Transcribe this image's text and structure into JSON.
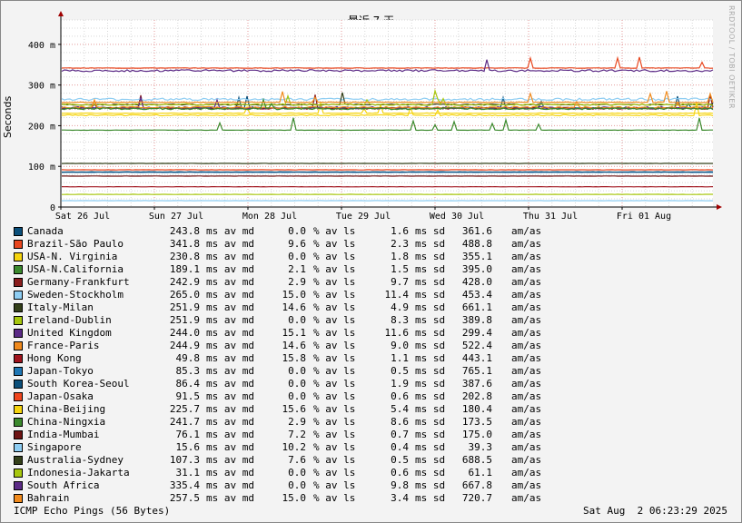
{
  "chart_data": {
    "type": "line",
    "title": "最近 7 天",
    "ylabel": "Seconds",
    "ylim": [
      0,
      460
    ],
    "yticks": [
      {
        "value": 0,
        "label": "0"
      },
      {
        "value": 100,
        "label": "100 m"
      },
      {
        "value": 200,
        "label": "200 m"
      },
      {
        "value": 300,
        "label": "300 m"
      },
      {
        "value": 400,
        "label": "400 m"
      }
    ],
    "xticks": [
      "Sat 26 Jul",
      "Sun 27 Jul",
      "Mon 28 Jul",
      "Tue 29 Jul",
      "Wed 30 Jul",
      "Thu 31 Jul",
      "Fri 01 Aug"
    ],
    "grid": true,
    "watermark": "RRDTOOL / TOBI OETIKER",
    "series": [
      {
        "name": "Canada",
        "median": "243.8",
        "median_unit": "ms av md",
        "loss": "0.0",
        "loss_unit": "% av ls",
        "sd": "1.6",
        "sd_unit": "ms sd",
        "ratio": "361.6",
        "ratio_unit": "am/as",
        "color": "#0b4f7a",
        "y": 243.8
      },
      {
        "name": "Brazil-São Paulo",
        "median": "341.8",
        "median_unit": "ms av md",
        "loss": "9.6",
        "loss_unit": "% av ls",
        "sd": "2.3",
        "sd_unit": "ms sd",
        "ratio": "488.8",
        "ratio_unit": "am/as",
        "color": "#e8461e",
        "y": 341.8
      },
      {
        "name": "USA-N. Virginia",
        "median": "230.8",
        "median_unit": "ms av md",
        "loss": "0.0",
        "loss_unit": "% av ls",
        "sd": "1.8",
        "sd_unit": "ms sd",
        "ratio": "355.1",
        "ratio_unit": "am/as",
        "color": "#f5d40f",
        "y": 230.8
      },
      {
        "name": "USA-N.California",
        "median": "189.1",
        "median_unit": "ms av md",
        "loss": "2.1",
        "loss_unit": "% av ls",
        "sd": "1.5",
        "sd_unit": "ms sd",
        "ratio": "395.0",
        "ratio_unit": "am/as",
        "color": "#3c8a2e",
        "y": 189.1
      },
      {
        "name": "Germany-Frankfurt",
        "median": "242.9",
        "median_unit": "ms av md",
        "loss": "2.9",
        "loss_unit": "% av ls",
        "sd": "9.7",
        "sd_unit": "ms sd",
        "ratio": "428.0",
        "ratio_unit": "am/as",
        "color": "#8a1e1e",
        "y": 242.9
      },
      {
        "name": "Sweden-Stockholm",
        "median": "265.0",
        "median_unit": "ms av md",
        "loss": "15.0",
        "loss_unit": "% av ls",
        "sd": "11.4",
        "sd_unit": "ms sd",
        "ratio": "453.4",
        "ratio_unit": "am/as",
        "color": "#8ecdf2",
        "y": 265.0
      },
      {
        "name": "Italy-Milan",
        "median": "251.9",
        "median_unit": "ms av md",
        "loss": "14.6",
        "loss_unit": "% av ls",
        "sd": "4.9",
        "sd_unit": "ms sd",
        "ratio": "661.1",
        "ratio_unit": "am/as",
        "color": "#34401a",
        "y": 251.9
      },
      {
        "name": "Ireland-Dublin",
        "median": "251.9",
        "median_unit": "ms av md",
        "loss": "0.0",
        "loss_unit": "% av ls",
        "sd": "8.3",
        "sd_unit": "ms sd",
        "ratio": "389.8",
        "ratio_unit": "am/as",
        "color": "#a7c70e",
        "y": 251.9
      },
      {
        "name": "United Kingdom",
        "median": "244.0",
        "median_unit": "ms av md",
        "loss": "15.1",
        "loss_unit": "% av ls",
        "sd": "11.6",
        "sd_unit": "ms sd",
        "ratio": "299.4",
        "ratio_unit": "am/as",
        "color": "#5b2a86",
        "y": 244.0
      },
      {
        "name": "France-Paris",
        "median": "244.9",
        "median_unit": "ms av md",
        "loss": "14.6",
        "loss_unit": "% av ls",
        "sd": "9.0",
        "sd_unit": "ms sd",
        "ratio": "522.4",
        "ratio_unit": "am/as",
        "color": "#f08a1d",
        "y": 244.9
      },
      {
        "name": "Hong Kong",
        "median": "49.8",
        "median_unit": "ms av md",
        "loss": "15.8",
        "loss_unit": "% av ls",
        "sd": "1.1",
        "sd_unit": "ms sd",
        "ratio": "443.1",
        "ratio_unit": "am/as",
        "color": "#a0141e",
        "y": 49.8
      },
      {
        "name": "Japan-Tokyo",
        "median": "85.3",
        "median_unit": "ms av md",
        "loss": "0.0",
        "loss_unit": "% av ls",
        "sd": "0.5",
        "sd_unit": "ms sd",
        "ratio": "765.1",
        "ratio_unit": "am/as",
        "color": "#1f77b4",
        "y": 85.3
      },
      {
        "name": "South Korea-Seoul",
        "median": "86.4",
        "median_unit": "ms av md",
        "loss": "0.0",
        "loss_unit": "% av ls",
        "sd": "1.9",
        "sd_unit": "ms sd",
        "ratio": "387.6",
        "ratio_unit": "am/as",
        "color": "#0b4f7a",
        "y": 86.4
      },
      {
        "name": "Japan-Osaka",
        "median": "91.5",
        "median_unit": "ms av md",
        "loss": "0.0",
        "loss_unit": "% av ls",
        "sd": "0.6",
        "sd_unit": "ms sd",
        "ratio": "202.8",
        "ratio_unit": "am/as",
        "color": "#f0461e",
        "y": 91.5
      },
      {
        "name": "China-Beijing",
        "median": "225.7",
        "median_unit": "ms av md",
        "loss": "15.6",
        "loss_unit": "% av ls",
        "sd": "5.4",
        "sd_unit": "ms sd",
        "ratio": "180.4",
        "ratio_unit": "am/as",
        "color": "#f5d40f",
        "y": 225.7
      },
      {
        "name": "China-Ningxia",
        "median": "241.7",
        "median_unit": "ms av md",
        "loss": "2.9",
        "loss_unit": "% av ls",
        "sd": "8.6",
        "sd_unit": "ms sd",
        "ratio": "173.5",
        "ratio_unit": "am/as",
        "color": "#3c8a2e",
        "y": 241.7
      },
      {
        "name": "India-Mumbai",
        "median": "76.1",
        "median_unit": "ms av md",
        "loss": "7.2",
        "loss_unit": "% av ls",
        "sd": "0.7",
        "sd_unit": "ms sd",
        "ratio": "175.0",
        "ratio_unit": "am/as",
        "color": "#6e1414",
        "y": 76.1
      },
      {
        "name": "Singapore",
        "median": "15.6",
        "median_unit": "ms av md",
        "loss": "10.2",
        "loss_unit": "% av ls",
        "sd": "0.4",
        "sd_unit": "ms sd",
        "ratio": "39.3",
        "ratio_unit": "am/as",
        "color": "#8ecdf2",
        "y": 15.6
      },
      {
        "name": "Australia-Sydney",
        "median": "107.3",
        "median_unit": "ms av md",
        "loss": "7.6",
        "loss_unit": "% av ls",
        "sd": "0.5",
        "sd_unit": "ms sd",
        "ratio": "688.5",
        "ratio_unit": "am/as",
        "color": "#34401a",
        "y": 107.3
      },
      {
        "name": "Indonesia-Jakarta",
        "median": "31.1",
        "median_unit": "ms av md",
        "loss": "0.0",
        "loss_unit": "% av ls",
        "sd": "0.6",
        "sd_unit": "ms sd",
        "ratio": "61.1",
        "ratio_unit": "am/as",
        "color": "#a7c70e",
        "y": 31.1
      },
      {
        "name": "South Africa",
        "median": "335.4",
        "median_unit": "ms av md",
        "loss": "0.0",
        "loss_unit": "% av ls",
        "sd": "9.8",
        "sd_unit": "ms sd",
        "ratio": "667.8",
        "ratio_unit": "am/as",
        "color": "#5b2a86",
        "y": 335.4
      },
      {
        "name": "Bahrain",
        "median": "257.5",
        "median_unit": "ms av md",
        "loss": "15.0",
        "loss_unit": "% av ls",
        "sd": "3.4",
        "sd_unit": "ms sd",
        "ratio": "720.7",
        "ratio_unit": "am/as",
        "color": "#f08a1d",
        "y": 257.5
      }
    ]
  },
  "footer": {
    "probe": "ICMP Echo Pings (56 Bytes)",
    "timestamp": "Sat Aug  2 06:23:29 2025"
  }
}
